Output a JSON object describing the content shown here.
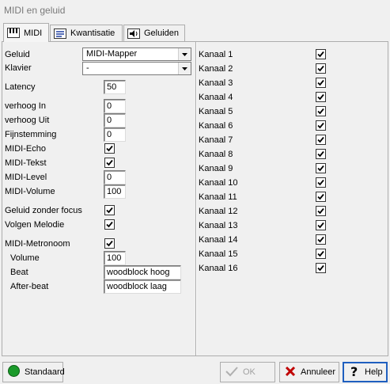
{
  "window": {
    "title": "MIDI en geluid"
  },
  "tabs": [
    {
      "label": "MIDI",
      "icon": "piano-icon"
    },
    {
      "label": "Kwantisatie",
      "icon": "quantize-icon"
    },
    {
      "label": "Geluiden",
      "icon": "speaker-icon"
    }
  ],
  "left": {
    "geluid_label": "Geluid",
    "geluid_value": "MIDI-Mapper",
    "klavier_label": "Klavier",
    "klavier_value": "-",
    "latency_label": "Latency",
    "latency_value": "50",
    "verhoog_in_label": "verhoog In",
    "verhoog_in_value": "0",
    "verhoog_uit_label": "verhoog Uit",
    "verhoog_uit_value": "0",
    "fijnstemming_label": "Fijnstemming",
    "fijnstemming_value": "0",
    "midi_echo_label": "MIDI-Echo",
    "midi_tekst_label": "MIDI-Tekst",
    "midi_level_label": "MIDI-Level",
    "midi_level_value": "0",
    "midi_volume_label": "MIDI-Volume",
    "midi_volume_value": "100",
    "geluid_zonder_focus_label": "Geluid zonder focus",
    "volgen_melodie_label": "Volgen Melodie",
    "midi_metronoom_label": "MIDI-Metronoom",
    "volume_label": "Volume",
    "volume_value": "100",
    "beat_label": "Beat",
    "beat_value": "woodblock hoog",
    "afterbeat_label": "After-beat",
    "afterbeat_value": "woodblock laag"
  },
  "channels": [
    {
      "label": "Kanaal 1",
      "checked": true
    },
    {
      "label": "Kanaal 2",
      "checked": true
    },
    {
      "label": "Kanaal 3",
      "checked": true
    },
    {
      "label": "Kanaal 4",
      "checked": true
    },
    {
      "label": "Kanaal 5",
      "checked": true
    },
    {
      "label": "Kanaal 6",
      "checked": true
    },
    {
      "label": "Kanaal 7",
      "checked": true
    },
    {
      "label": "Kanaal 8",
      "checked": true
    },
    {
      "label": "Kanaal 9",
      "checked": true
    },
    {
      "label": "Kanaal 10",
      "checked": true
    },
    {
      "label": "Kanaal 11",
      "checked": true
    },
    {
      "label": "Kanaal 12",
      "checked": true
    },
    {
      "label": "Kanaal 13",
      "checked": true
    },
    {
      "label": "Kanaal 14",
      "checked": true
    },
    {
      "label": "Kanaal 15",
      "checked": true
    },
    {
      "label": "Kanaal 16",
      "checked": true
    }
  ],
  "buttons": {
    "standaard": "Standaard",
    "ok": "OK",
    "annuleer": "Annuleer",
    "help": "Help"
  },
  "colors": {
    "standaard_icon": "#1a9a2a",
    "cancel_icon": "#c00000",
    "help_border": "#1f5fbf"
  }
}
